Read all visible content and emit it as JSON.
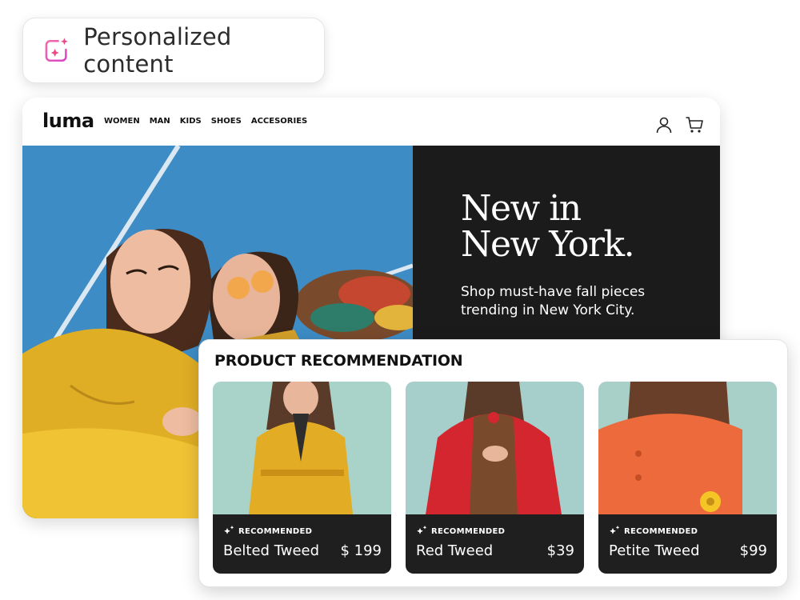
{
  "badge": {
    "label": "Personalized content",
    "icon": "sparkle-frame-icon"
  },
  "site": {
    "logo": "luma",
    "menu": [
      "WOMEN",
      "MAN",
      "KIDS",
      "SHOES",
      "ACCESORIES"
    ],
    "icons": [
      "user-icon",
      "cart-icon"
    ],
    "hero": {
      "headline_line1": "New in",
      "headline_line2": "New York.",
      "subtitle": "Shop must-have fall pieces trending in New York City."
    }
  },
  "recommendation": {
    "title": "PRODUCT RECOMMENDATION",
    "products": [
      {
        "tag": "RECOMMENDED",
        "name": "Belted Tweed",
        "price": "$ 199",
        "color": "#e2ac24"
      },
      {
        "tag": "RECOMMENDED",
        "name": "Red Tweed",
        "price": "$39",
        "color": "#d4262e"
      },
      {
        "tag": "RECOMMENDED",
        "name": "Petite Tweed",
        "price": "$99",
        "color": "#ec6a3b"
      }
    ]
  },
  "colors": {
    "accent": "#e94b8a",
    "dark_panel": "#1b1b1b",
    "sky": "#3f8fc7"
  }
}
